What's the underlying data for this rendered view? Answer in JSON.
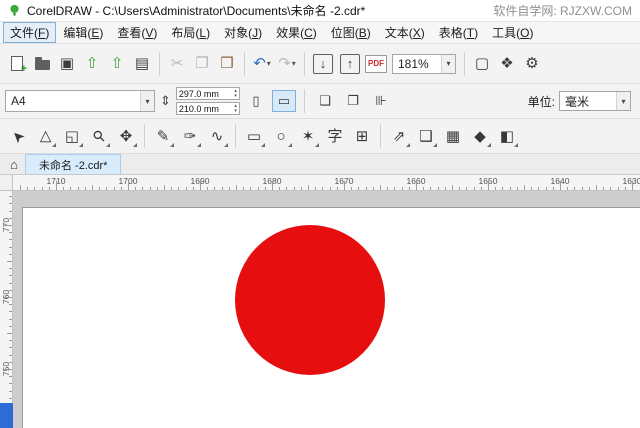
{
  "colors": {
    "logo_green": "#3aaa35",
    "accent_blue": "#2f6bd7"
  },
  "title_bar": {
    "title": "CorelDRAW - C:\\Users\\Administrator\\Documents\\未命名 -2.cdr*",
    "watermark": "软件自学网: RJZXW.COM"
  },
  "menu_bar": {
    "items": [
      {
        "pre": "文件(",
        "key": "F",
        "post": ")",
        "active": true
      },
      {
        "pre": "编辑(",
        "key": "E",
        "post": ")"
      },
      {
        "pre": "查看(",
        "key": "V",
        "post": ")"
      },
      {
        "pre": "布局(",
        "key": "L",
        "post": ")"
      },
      {
        "pre": "对象(",
        "key": "J",
        "post": ")"
      },
      {
        "pre": "效果(",
        "key": "C",
        "post": ")"
      },
      {
        "pre": "位图(",
        "key": "B",
        "post": ")"
      },
      {
        "pre": "文本(",
        "key": "X",
        "post": ")"
      },
      {
        "pre": "表格(",
        "key": "T",
        "post": ")"
      },
      {
        "pre": "工具(",
        "key": "O",
        "post": ")"
      }
    ]
  },
  "standard_toolbar": {
    "items": [
      {
        "type": "newdoc",
        "name": "new-document-button"
      },
      {
        "type": "folder",
        "name": "open-button"
      },
      {
        "type": "button",
        "name": "save-button",
        "glyph": "▣"
      },
      {
        "type": "button",
        "name": "open-from-cloud-button",
        "glyph": "⇧",
        "color": "#3fa13a"
      },
      {
        "type": "button",
        "name": "save-to-cloud-button",
        "glyph": "⇧",
        "color": "#3fa13a"
      },
      {
        "type": "button",
        "name": "print-button",
        "glyph": "▤"
      },
      {
        "type": "separator"
      },
      {
        "type": "button",
        "name": "cut-button",
        "glyph": "✂",
        "disabled": true
      },
      {
        "type": "button",
        "name": "copy-button",
        "glyph": "❐",
        "disabled": true
      },
      {
        "type": "button",
        "name": "paste-button",
        "glyph": "❒",
        "color": "#8a6a3f"
      },
      {
        "type": "separator"
      },
      {
        "type": "button",
        "name": "undo-button",
        "glyph": "↶",
        "color": "#2a70c2",
        "dropdown": true
      },
      {
        "type": "button",
        "name": "redo-button",
        "glyph": "↷",
        "disabled": true,
        "dropdown": true
      },
      {
        "type": "separator"
      },
      {
        "type": "button",
        "name": "import-button",
        "glyph": "↓",
        "boxed": true
      },
      {
        "type": "button",
        "name": "export-button",
        "glyph": "↑",
        "boxed": true
      },
      {
        "type": "pdf",
        "name": "publish-to-pdf-button",
        "glyph": "PDF"
      },
      {
        "type": "zoom",
        "name": "zoom-level-combo",
        "value": "181%"
      },
      {
        "type": "separator"
      },
      {
        "type": "button",
        "name": "full-screen-preview-button",
        "glyph": "▢"
      },
      {
        "type": "button",
        "name": "window-layout-button",
        "glyph": "❖"
      },
      {
        "type": "button",
        "name": "options-button",
        "glyph": "⚙"
      }
    ]
  },
  "property_bar": {
    "page_size_value": "A4",
    "page_width": "297.0 mm",
    "page_height": "210.0 mm",
    "units_label": "单位:",
    "units_value": "毫米",
    "icons": {
      "chevron": "▾",
      "paper_metrics": "⇕",
      "portrait": "▯",
      "landscape": "▭",
      "all_pages": "❏",
      "facing_pages": "❐",
      "scale": "⊪",
      "spinner_up": "▴",
      "spinner_down": "▾"
    }
  },
  "toolbox": {
    "items": [
      {
        "name": "pick-tool",
        "glyph": "➤",
        "rot": -135
      },
      {
        "name": "shape-tool",
        "glyph": "▷",
        "rot": -90,
        "flyout": true
      },
      {
        "name": "crop-tool",
        "glyph": "◱",
        "flyout": true
      },
      {
        "name": "zoom-tool",
        "glyph": "⚲",
        "rot": -45,
        "flyout": true
      },
      {
        "name": "pan-tool",
        "glyph": "✥",
        "flyout": true
      },
      {
        "type": "separator"
      },
      {
        "name": "freehand-tool",
        "glyph": "✎",
        "flyout": true
      },
      {
        "name": "artistic-media-tool",
        "glyph": "✑",
        "flyout": true
      },
      {
        "name": "bezier-tool",
        "glyph": "∿",
        "flyout": true
      },
      {
        "type": "separator"
      },
      {
        "name": "rectangle-tool",
        "glyph": "▭",
        "flyout": true
      },
      {
        "name": "ellipse-tool",
        "glyph": "○",
        "flyout": true
      },
      {
        "name": "polygon-tool",
        "glyph": "✶",
        "flyout": true
      },
      {
        "name": "text-tool",
        "glyph": "字"
      },
      {
        "name": "table-tool",
        "glyph": "⊞"
      },
      {
        "type": "separator"
      },
      {
        "name": "dimension-tool",
        "glyph": "⇗",
        "flyout": true
      },
      {
        "name": "drop-shadow-tool",
        "glyph": "❑",
        "flyout": true
      },
      {
        "name": "transparency-tool",
        "glyph": "▦"
      },
      {
        "name": "eyedropper-tool",
        "glyph": "◆",
        "flyout": true
      },
      {
        "name": "interactive-fill-tool",
        "glyph": "◧",
        "flyout": true
      }
    ]
  },
  "document_tabs": {
    "home_icon": "⌂",
    "tabs": [
      {
        "label": "未命名 -2.cdr*",
        "active": true
      }
    ]
  },
  "rulers": {
    "horizontal_labels": [
      "1710",
      "1700",
      "1690",
      "1680",
      "1670",
      "1660",
      "1650",
      "1640",
      "1630"
    ],
    "vertical_labels": [
      "770",
      "760",
      "750"
    ]
  },
  "canvas": {
    "page_color": "#ffffff",
    "shape": "circle",
    "circle_color": "#e60e0e"
  }
}
